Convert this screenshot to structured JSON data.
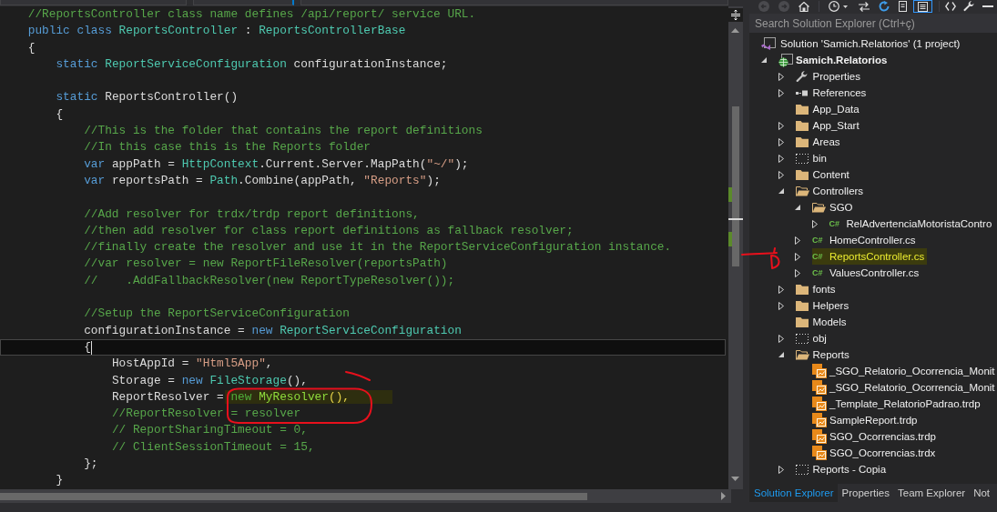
{
  "editor": {
    "lines": [
      {
        "tokens": [
          {
            "kind": "comment",
            "text": "//ReportsController class name defines /api/report/ service URL."
          }
        ],
        "current": false
      },
      {
        "tokens": [
          {
            "kind": "keyword",
            "text": "public class "
          },
          {
            "kind": "type",
            "text": "ReportsController"
          },
          {
            "kind": "plain",
            "text": " : "
          },
          {
            "kind": "type",
            "text": "ReportsControllerBase"
          }
        ],
        "current": false
      },
      {
        "tokens": [
          {
            "kind": "plain",
            "text": "{"
          }
        ],
        "current": false,
        "children": [
          {
            "tokens": [
              {
                "kind": "keyword",
                "text": "static "
              },
              {
                "kind": "type",
                "text": "ReportServiceConfiguration"
              },
              {
                "kind": "plain",
                "text": " configurationInstance;"
              }
            ],
            "current": false
          },
          {
            "current": false
          },
          {
            "tokens": [
              {
                "kind": "keyword",
                "text": "static "
              },
              {
                "kind": "plain",
                "text": "ReportsController()"
              }
            ],
            "current": false
          },
          {
            "tokens": [
              {
                "kind": "plain",
                "text": "{"
              }
            ],
            "current": false,
            "children": [
              {
                "tokens": [
                  {
                    "kind": "comment",
                    "text": "//This is the folder that contains the report definitions"
                  }
                ],
                "current": false
              },
              {
                "tokens": [
                  {
                    "kind": "comment",
                    "text": "//In this case this is the Reports folder"
                  }
                ],
                "current": false
              },
              {
                "tokens": [
                  {
                    "kind": "keyword",
                    "text": "var "
                  },
                  {
                    "kind": "plain",
                    "text": "appPath = "
                  },
                  {
                    "kind": "type",
                    "text": "HttpContext"
                  },
                  {
                    "kind": "plain",
                    "text": ".Current.Server.MapPath("
                  },
                  {
                    "kind": "string",
                    "text": "\"~/\""
                  },
                  {
                    "kind": "plain",
                    "text": ");"
                  }
                ],
                "current": false
              },
              {
                "tokens": [
                  {
                    "kind": "keyword",
                    "text": "var "
                  },
                  {
                    "kind": "plain",
                    "text": "reportsPath = "
                  },
                  {
                    "kind": "type",
                    "text": "Path"
                  },
                  {
                    "kind": "plain",
                    "text": ".Combine(appPath, "
                  },
                  {
                    "kind": "string",
                    "text": "\"Reports\""
                  },
                  {
                    "kind": "plain",
                    "text": ");"
                  }
                ],
                "current": false
              },
              {
                "current": false
              },
              {
                "tokens": [
                  {
                    "kind": "comment",
                    "text": "//Add resolver for trdx/trdp report definitions,"
                  }
                ],
                "current": false
              },
              {
                "tokens": [
                  {
                    "kind": "comment",
                    "text": "//then add resolver for class report definitions as fallback resolver;"
                  }
                ],
                "current": false
              },
              {
                "tokens": [
                  {
                    "kind": "comment",
                    "text": "//finally create the resolver and use it in the ReportServiceConfiguration instance."
                  }
                ],
                "current": false
              },
              {
                "tokens": [
                  {
                    "kind": "comment",
                    "text": "//var resolver = new ReportFileResolver(reportsPath)"
                  }
                ],
                "current": false
              },
              {
                "tokens": [
                  {
                    "kind": "comment",
                    "text": "//    .AddFallbackResolver(new ReportTypeResolver());"
                  }
                ],
                "current": false
              },
              {
                "current": false
              },
              {
                "tokens": [
                  {
                    "kind": "comment",
                    "text": "//Setup the ReportServiceConfiguration"
                  }
                ],
                "current": false
              },
              {
                "tokens": [
                  {
                    "kind": "plain",
                    "text": "configurationInstance = "
                  },
                  {
                    "kind": "keyword",
                    "text": "new "
                  },
                  {
                    "kind": "type",
                    "text": "ReportServiceConfiguration"
                  }
                ],
                "current": false
              },
              {
                "tokens": [
                  {
                    "kind": "plain",
                    "text": "{"
                  }
                ],
                "current": true,
                "children": [
                  {
                    "tokens": [
                      {
                        "kind": "plain",
                        "text": "HostAppId = "
                      },
                      {
                        "kind": "string",
                        "text": "\"Html5App\""
                      },
                      {
                        "kind": "plain",
                        "text": ","
                      }
                    ],
                    "current": false
                  },
                  {
                    "tokens": [
                      {
                        "kind": "plain",
                        "text": "Storage = "
                      },
                      {
                        "kind": "keyword",
                        "text": "new "
                      },
                      {
                        "kind": "type",
                        "text": "FileStorage"
                      },
                      {
                        "kind": "plain",
                        "text": "(),"
                      }
                    ],
                    "current": false
                  },
                  {
                    "tokens": [
                      {
                        "kind": "plain",
                        "text": "ReportResolver = "
                      },
                      {
                        "kind": "marked-keyword",
                        "text": "new "
                      },
                      {
                        "kind": "marked-type",
                        "text": "MyResolver"
                      },
                      {
                        "kind": "marked-punct",
                        "text": "(),"
                      }
                    ],
                    "current": false
                  },
                  {
                    "tokens": [
                      {
                        "kind": "comment",
                        "text": "//ReportResolver = resolver"
                      }
                    ],
                    "current": false
                  },
                  {
                    "tokens": [
                      {
                        "kind": "comment",
                        "text": "// ReportSharingTimeout = 0,"
                      }
                    ],
                    "current": false
                  },
                  {
                    "tokens": [
                      {
                        "kind": "comment",
                        "text": "// ClientSessionTimeout = 15,"
                      }
                    ],
                    "current": false
                  }
                ]
              },
              {
                "tokens": [
                  {
                    "kind": "plain",
                    "text": "};"
                  }
                ],
                "current": false
              }
            ]
          },
          {
            "tokens": [
              {
                "kind": "plain",
                "text": "}"
              }
            ],
            "current": false
          }
        ]
      }
    ]
  },
  "solution_explorer": {
    "search": {
      "placeholder": "Search Solution Explorer (Ctrl+ç)"
    },
    "tree": [
      {
        "kind": "solution",
        "label": "Solution 'Samich.Relatorios' (1 project)",
        "expandable": false,
        "selected": false,
        "children": [
          {
            "kind": "project",
            "label": "Samich.Relatorios",
            "expandable": true,
            "expanded": true,
            "selected": false,
            "children": [
              {
                "kind": "wrench",
                "label": "Properties",
                "expandable": true,
                "expanded": false,
                "selected": false
              },
              {
                "kind": "references",
                "label": "References",
                "expandable": true,
                "expanded": false,
                "selected": false
              },
              {
                "kind": "folder",
                "label": "App_Data",
                "expandable": false,
                "selected": false
              },
              {
                "kind": "folder",
                "label": "App_Start",
                "expandable": true,
                "expanded": false,
                "selected": false
              },
              {
                "kind": "folder",
                "label": "Areas",
                "expandable": true,
                "expanded": false,
                "selected": false
              },
              {
                "kind": "excluded-folder",
                "label": "bin",
                "expandable": true,
                "expanded": false,
                "selected": false
              },
              {
                "kind": "folder",
                "label": "Content",
                "expandable": true,
                "expanded": false,
                "selected": false
              },
              {
                "kind": "folder",
                "label": "Controllers",
                "expandable": true,
                "expanded": true,
                "selected": false,
                "children": [
                  {
                    "kind": "folder",
                    "label": "SGO",
                    "expandable": true,
                    "expanded": true,
                    "selected": false,
                    "children": [
                      {
                        "kind": "csharp",
                        "icon_text": "C#",
                        "label": "RelAdvertenciaMotoristaContro",
                        "expandable": true,
                        "expanded": false,
                        "selected": false
                      }
                    ]
                  },
                  {
                    "kind": "csharp",
                    "icon_text": "C#",
                    "label": "HomeController.cs",
                    "expandable": true,
                    "expanded": false,
                    "selected": false
                  },
                  {
                    "kind": "csharp",
                    "icon_text": "C#",
                    "label": "ReportsController.cs",
                    "expandable": true,
                    "expanded": false,
                    "selected": true
                  },
                  {
                    "kind": "csharp",
                    "icon_text": "C#",
                    "label": "ValuesController.cs",
                    "expandable": true,
                    "expanded": false,
                    "selected": false
                  }
                ]
              },
              {
                "kind": "folder",
                "label": "fonts",
                "expandable": true,
                "expanded": false,
                "selected": false
              },
              {
                "kind": "folder",
                "label": "Helpers",
                "expandable": true,
                "expanded": false,
                "selected": false
              },
              {
                "kind": "folder",
                "label": "Models",
                "expandable": false,
                "selected": false
              },
              {
                "kind": "excluded-folder",
                "label": "obj",
                "expandable": true,
                "expanded": false,
                "selected": false
              },
              {
                "kind": "folder",
                "label": "Reports",
                "expandable": true,
                "expanded": true,
                "selected": false,
                "children": [
                  {
                    "kind": "report",
                    "label": "_SGO_Relatorio_Ocorrencia_Monit",
                    "expandable": false,
                    "selected": false
                  },
                  {
                    "kind": "report",
                    "label": "_SGO_Relatorio_Ocorrencia_Monit",
                    "expandable": false,
                    "selected": false
                  },
                  {
                    "kind": "report",
                    "label": "_Template_RelatorioPadrao.trdp",
                    "expandable": false,
                    "selected": false
                  },
                  {
                    "kind": "report",
                    "label": "SampleReport.trdp",
                    "expandable": false,
                    "selected": false
                  },
                  {
                    "kind": "report",
                    "label": "SGO_Ocorrencias.trdp",
                    "expandable": false,
                    "selected": false
                  },
                  {
                    "kind": "report",
                    "label": "SGO_Ocorrencias.trdx",
                    "expandable": false,
                    "selected": false
                  }
                ]
              },
              {
                "kind": "excluded-folder",
                "label": "Reports - Copia",
                "expandable": true,
                "expanded": false,
                "selected": false
              }
            ]
          }
        ]
      }
    ],
    "tabs": [
      {
        "label": "Solution Explorer",
        "selected": true
      },
      {
        "label": "Properties",
        "selected": false
      },
      {
        "label": "Team Explorer",
        "selected": false
      },
      {
        "label": "Not",
        "selected": false
      }
    ]
  }
}
